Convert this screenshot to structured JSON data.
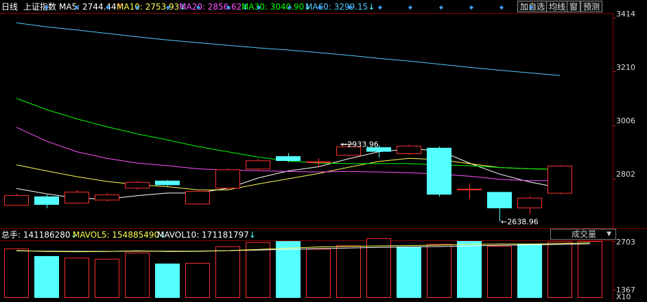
{
  "header": {
    "period": "日线",
    "index_name": "上证指数",
    "ma5": {
      "label": "MA5: 2744.44",
      "arrow": "↑",
      "color": "#ffffff",
      "arrow_color": "#ff3030"
    },
    "ma10": {
      "label": "MA10: 2753.93",
      "arrow": "↓",
      "color": "#ffff54",
      "arrow_color": "#54ffff"
    },
    "ma20": {
      "label": "MA20: 2856.62",
      "arrow": "↓",
      "color": "#ff54ff",
      "arrow_color": "#54ffff"
    },
    "ma30": {
      "label": "MA30: 3040.90",
      "arrow": "↓",
      "color": "#00ff00",
      "arrow_color": "#54ffff"
    },
    "ma60": {
      "label": "MA60: 3299.15",
      "arrow": "↓",
      "color": "#54c8ff",
      "arrow_color": "#54ffff"
    }
  },
  "toolbar": {
    "add_watch": "加自选",
    "ma_lines": "均线",
    "window": "窗",
    "forecast": "预测"
  },
  "price_axis": {
    "ticks": [
      "3414",
      "3210",
      "3006",
      "2802"
    ],
    "tick_values": [
      3414,
      3210,
      3006,
      2802
    ]
  },
  "volume_header": {
    "total": "总手: 141186280",
    "total_arrow": "↓",
    "mavol5": "MAVOL5: 154885490",
    "mavol5_arrow": "↓",
    "mavol10": "MAVOL10: 171181797",
    "mavol10_arrow": "↓",
    "selector": "成交量"
  },
  "volume_axis": {
    "ticks": [
      "2703",
      "1367"
    ],
    "unit": "X10"
  },
  "annotations": {
    "high": "2933.96",
    "low": "2638.96"
  },
  "colors": {
    "up": "#ff3030",
    "down": "#54ffff",
    "grid": "#8b0000"
  },
  "chart_data": {
    "type": "candlestick",
    "ylim": [
      2620,
      3430
    ],
    "candles": [
      {
        "open": 2700,
        "close": 2740,
        "high": 2745,
        "low": 2700,
        "dir": "up"
      },
      {
        "open": 2735,
        "close": 2703,
        "high": 2742,
        "low": 2690,
        "dir": "down"
      },
      {
        "open": 2708,
        "close": 2753,
        "high": 2760,
        "low": 2705,
        "dir": "up"
      },
      {
        "open": 2720,
        "close": 2742,
        "high": 2748,
        "low": 2716,
        "dir": "up"
      },
      {
        "open": 2765,
        "close": 2790,
        "high": 2795,
        "low": 2760,
        "dir": "up"
      },
      {
        "open": 2795,
        "close": 2778,
        "high": 2798,
        "low": 2772,
        "dir": "down"
      },
      {
        "open": 2705,
        "close": 2755,
        "high": 2760,
        "low": 2702,
        "dir": "up"
      },
      {
        "open": 2765,
        "close": 2838,
        "high": 2842,
        "low": 2762,
        "dir": "up"
      },
      {
        "open": 2838,
        "close": 2872,
        "high": 2878,
        "low": 2832,
        "dir": "up"
      },
      {
        "open": 2888,
        "close": 2870,
        "high": 2900,
        "low": 2865,
        "dir": "down"
      },
      {
        "open": 2865,
        "close": 2868,
        "high": 2880,
        "low": 2845,
        "dir": "up"
      },
      {
        "open": 2890,
        "close": 2925,
        "high": 2933.96,
        "low": 2885,
        "dir": "up"
      },
      {
        "open": 2922,
        "close": 2905,
        "high": 2930,
        "low": 2883,
        "dir": "down"
      },
      {
        "open": 2896,
        "close": 2928,
        "high": 2932,
        "low": 2893,
        "dir": "up"
      },
      {
        "open": 2920,
        "close": 2742,
        "high": 2925,
        "low": 2735,
        "dir": "down"
      },
      {
        "open": 2762,
        "close": 2764,
        "high": 2785,
        "low": 2725,
        "dir": "up"
      },
      {
        "open": 2752,
        "close": 2690,
        "high": 2752,
        "low": 2638.96,
        "dir": "down"
      },
      {
        "open": 2690,
        "close": 2730,
        "high": 2737,
        "low": 2668,
        "dir": "up"
      },
      {
        "open": 2746,
        "close": 2852,
        "high": 2855,
        "low": 2742,
        "dir": "up"
      }
    ],
    "ma": [
      {
        "name": "MA5",
        "color": "#ffffff",
        "values": [
          2765,
          2745,
          2728,
          2725,
          2738,
          2748,
          2748,
          2766,
          2805,
          2832,
          2848,
          2878,
          2905,
          2915,
          2910,
          2862,
          2820,
          2790,
          2768
        ]
      },
      {
        "name": "MA10",
        "color": "#ffff54",
        "values": [
          2855,
          2832,
          2810,
          2792,
          2780,
          2772,
          2760,
          2760,
          2782,
          2802,
          2822,
          2846,
          2868,
          2880,
          2875,
          2860,
          2845,
          2840,
          2838
        ]
      },
      {
        "name": "MA20",
        "color": "#ff54ff",
        "values": [
          2998,
          2945,
          2905,
          2880,
          2862,
          2852,
          2840,
          2835,
          2833,
          2830,
          2828,
          2830,
          2828,
          2825,
          2820,
          2812,
          2800,
          2795,
          2795
        ]
      },
      {
        "name": "MA30",
        "color": "#00ff00",
        "values": [
          3108,
          3065,
          3030,
          3000,
          2973,
          2950,
          2925,
          2905,
          2885,
          2870,
          2862,
          2860,
          2860,
          2860,
          2855,
          2852,
          2845,
          2840,
          2838
        ]
      },
      {
        "name": "MA60",
        "color": "#54c8ff",
        "values": [
          3395,
          3380,
          3368,
          3355,
          3342,
          3330,
          3320,
          3310,
          3300,
          3292,
          3282,
          3272,
          3260,
          3250,
          3238,
          3226,
          3215,
          3205,
          3195
        ]
      }
    ],
    "volume": {
      "ylim": [
        0,
        2703
      ],
      "values": [
        2350,
        1980,
        1900,
        1850,
        2150,
        1620,
        1650,
        2450,
        2650,
        2700,
        2330,
        2490,
        2840,
        2440,
        2560,
        2703,
        2470,
        2560,
        2680,
        2703
      ],
      "dirs": [
        "up",
        "down",
        "up",
        "up",
        "up",
        "down",
        "up",
        "up",
        "up",
        "down",
        "up",
        "up",
        "up",
        "down",
        "up",
        "down",
        "up",
        "down",
        "up",
        "up"
      ],
      "mavol5": [
        2250,
        2200,
        2190,
        2200,
        2230,
        2200,
        2210,
        2240,
        2300,
        2360,
        2420,
        2450,
        2470,
        2490,
        2510,
        2540,
        2560,
        2560,
        2580,
        2620
      ],
      "mavol10": [
        2230,
        2220,
        2210,
        2210,
        2220,
        2215,
        2220,
        2240,
        2270,
        2300,
        2340,
        2370,
        2400,
        2420,
        2440,
        2470,
        2500,
        2520,
        2540,
        2570
      ]
    }
  }
}
